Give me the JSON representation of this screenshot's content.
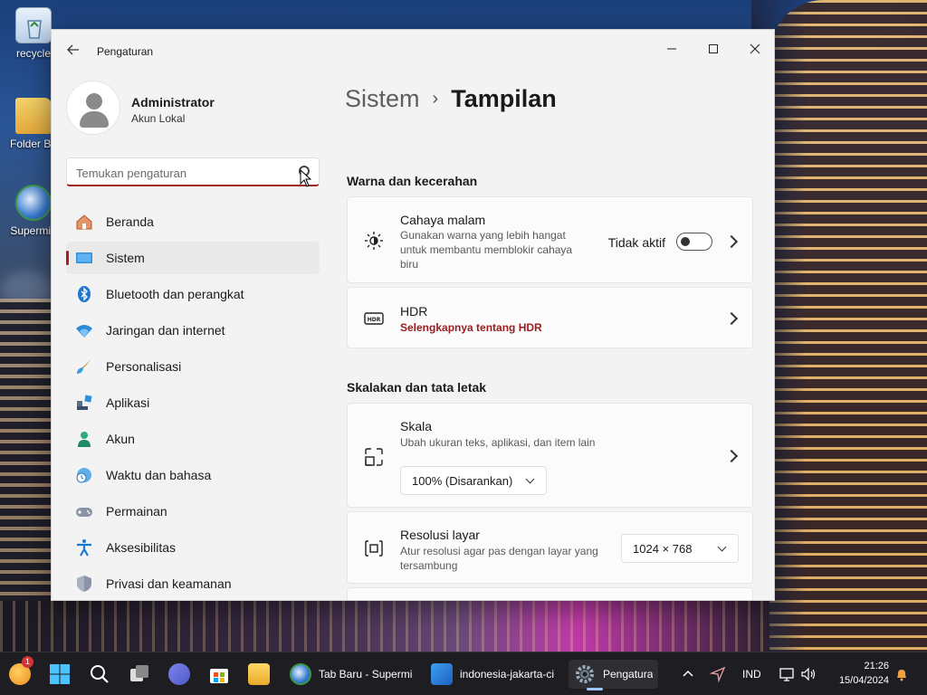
{
  "desktop": {
    "icons": [
      {
        "label": "recycle"
      },
      {
        "label": "Folder Ba"
      },
      {
        "label": "Supermiu"
      }
    ]
  },
  "window": {
    "title": "Pengaturan"
  },
  "profile": {
    "name": "Administrator",
    "account_type": "Akun Lokal"
  },
  "search": {
    "placeholder": "Temukan pengaturan"
  },
  "nav": {
    "items": [
      {
        "label": "Beranda",
        "icon": "home-icon",
        "active": false
      },
      {
        "label": "Sistem",
        "icon": "system-icon",
        "active": true
      },
      {
        "label": "Bluetooth dan perangkat",
        "icon": "bluetooth-icon",
        "active": false
      },
      {
        "label": "Jaringan dan internet",
        "icon": "wifi-icon",
        "active": false
      },
      {
        "label": "Personalisasi",
        "icon": "brush-icon",
        "active": false
      },
      {
        "label": "Aplikasi",
        "icon": "apps-icon",
        "active": false
      },
      {
        "label": "Akun",
        "icon": "account-icon",
        "active": false
      },
      {
        "label": "Waktu dan bahasa",
        "icon": "clock-globe-icon",
        "active": false
      },
      {
        "label": "Permainan",
        "icon": "gamepad-icon",
        "active": false
      },
      {
        "label": "Aksesibilitas",
        "icon": "accessibility-icon",
        "active": false
      },
      {
        "label": "Privasi dan keamanan",
        "icon": "shield-icon",
        "active": false
      }
    ]
  },
  "breadcrumb": {
    "parent": "Sistem",
    "separator": "›",
    "current": "Tampilan"
  },
  "sections": {
    "brightness_title": "Warna dan kecerahan",
    "scale_title": "Skalakan dan tata letak"
  },
  "night_light": {
    "title": "Cahaya malam",
    "desc_1": "Gunakan warna yang lebih hangat",
    "desc_2": "untuk membantu memblokir cahaya",
    "desc_3": "biru",
    "status": "Tidak aktif",
    "enabled": false
  },
  "hdr": {
    "title": "HDR",
    "link": "Selengkapnya tentang HDR"
  },
  "scale": {
    "title": "Skala",
    "desc": "Ubah ukuran teks, aplikasi, dan item lain",
    "value": "100% (Disarankan)"
  },
  "resolution": {
    "title": "Resolusi layar",
    "desc_1": "Atur resolusi agar pas dengan layar yang",
    "desc_2": "tersambung",
    "value": "1024 × 768"
  },
  "taskbar": {
    "notification_count": "1",
    "apps": [
      {
        "label": "Tab Baru - Supermi",
        "icon": "browser-icon"
      },
      {
        "label": "indonesia-jakarta-ci",
        "icon": "photos-icon"
      },
      {
        "label": "Pengatura",
        "icon": "settings-icon"
      }
    ],
    "language": "IND",
    "time": "21:26",
    "date": "15/04/2024"
  },
  "colors": {
    "accent": "#a52020",
    "link": "#9b1c1c",
    "window_bg": "#f3f3f3",
    "taskbar_bg": "#1e1e22"
  }
}
